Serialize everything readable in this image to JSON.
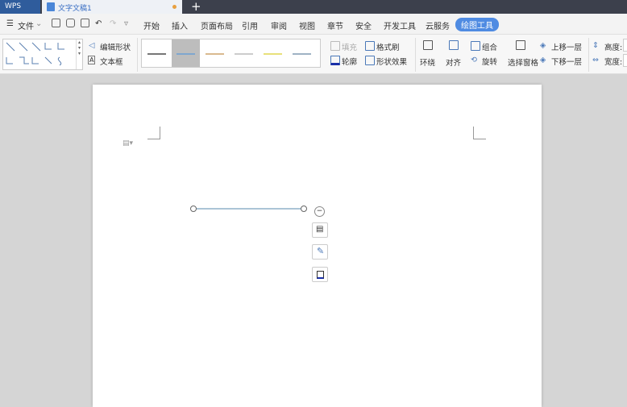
{
  "tabs": {
    "app": "WPS",
    "document": "文字文稿1",
    "new_tab": "+"
  },
  "menu": {
    "file": "文件",
    "items": [
      "开始",
      "插入",
      "页面布局",
      "引用",
      "审阅",
      "视图",
      "章节",
      "安全",
      "开发工具",
      "云服务"
    ],
    "active": "绘图工具"
  },
  "ribbon": {
    "edit_shape": "编辑形状",
    "text_box": "文本框",
    "fill": "填充",
    "format_painter": "格式刷",
    "outline": "轮廓",
    "shape_effects": "形状效果",
    "wrap": "环绕",
    "align": "对齐",
    "group": "组合",
    "rotate": "旋转",
    "selection_pane": "选择窗格",
    "bring_forward": "上移一层",
    "send_backward": "下移一层",
    "height": "高度:",
    "width": "宽度:"
  },
  "line_styles": [
    "#777777",
    "#7fa7cf",
    "#d9b98f",
    "#cccccc",
    "#e8e07a",
    "#9fb2c4"
  ],
  "accent": "#4f8be2"
}
